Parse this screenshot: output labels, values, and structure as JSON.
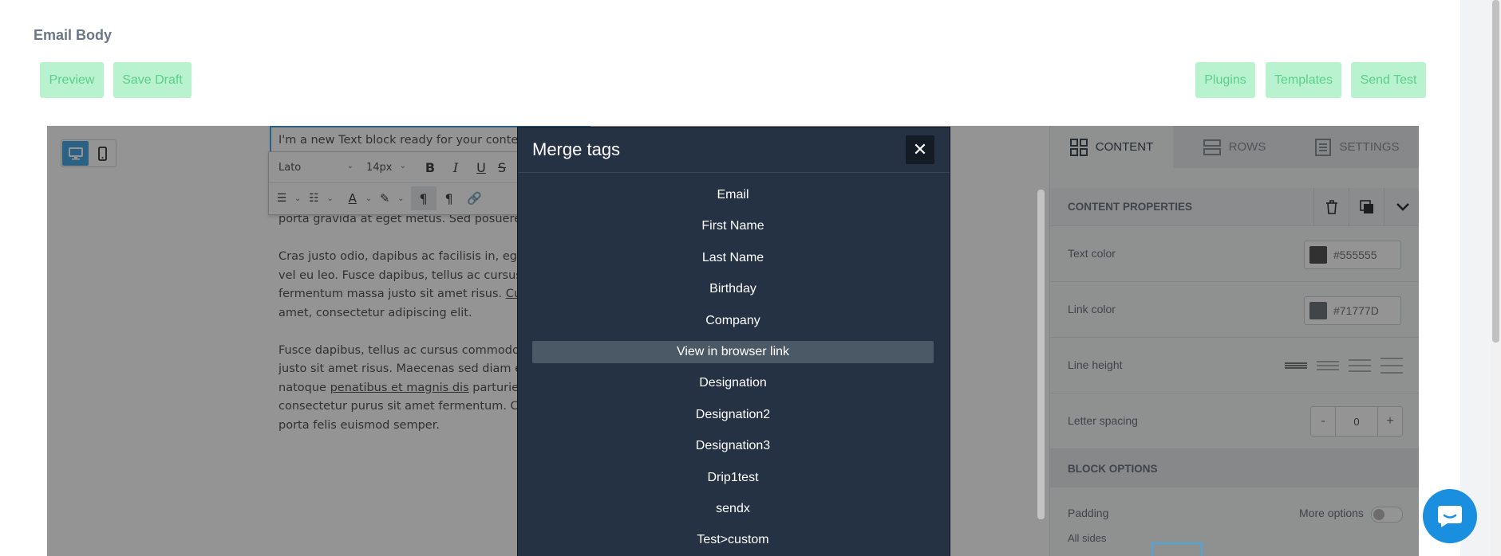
{
  "page": {
    "title": "Email Body"
  },
  "buttons": {
    "preview": "Preview",
    "save_draft": "Save Draft",
    "plugins": "Plugins",
    "templates": "Templates",
    "send_test": "Send Test"
  },
  "canvas": {
    "first_line": "I'm a new Text block ready for your content.",
    "line_2": "porta gravida at eget metus. Sed posuere co",
    "para2": [
      "Cras justo odio, dapibus ac facilisis in, egesta",
      "vel eu leo. Fusce dapibus, tellus ac cursus co",
      "fermentum massa justo sit amet risus. ",
      "amet, consectetur adipiscing elit."
    ],
    "para2_link": "Curab",
    "para3": [
      "Fusce dapibus, tellus ac cursus commodo, to",
      "justo sit amet risus. Maecenas sed diam eget",
      "natoque ",
      "consectetur purus sit amet fermentum. Cura",
      "porta felis euismod semper."
    ],
    "para3_link": "penatibus et magnis dis",
    "para3_after_link": " parturient"
  },
  "toolbar": {
    "font": "Lato",
    "size": "14px"
  },
  "panel": {
    "tabs": [
      "CONTENT",
      "ROWS",
      "SETTINGS"
    ],
    "content_properties": "CONTENT PROPERTIES",
    "text_color_label": "Text color",
    "text_color": "#555555",
    "link_color_label": "Link color",
    "link_color": "#71777D",
    "line_height_label": "Line height",
    "letter_spacing_label": "Letter spacing",
    "letter_spacing_value": "0",
    "minus": "-",
    "plus": "+",
    "block_options": "BLOCK OPTIONS",
    "padding_label": "Padding",
    "more_options": "More options",
    "all_sides": "All sides"
  },
  "modal": {
    "title": "Merge tags",
    "close": "✕",
    "tags": [
      "Email",
      "First Name",
      "Last Name",
      "Birthday",
      "Company",
      "View in browser link",
      "Designation",
      "Designation2",
      "Designation3",
      "Drip1test",
      "sendx",
      "Test>custom"
    ],
    "highlighted": "View in browser link"
  },
  "colors": {
    "accent_green": "#b9f2cf",
    "accent_green_text": "#5ad08a",
    "modal_bg": "#243244",
    "device_active": "#4aa7e6",
    "chat": "#1a8fe0"
  },
  "icons": [
    "desktop-icon",
    "mobile-icon",
    "bold-icon",
    "italic-icon",
    "underline-icon",
    "strikethrough-icon",
    "ordered-list-icon",
    "bullet-list-icon",
    "font-color-icon",
    "highlight-icon",
    "ltr-icon",
    "rtl-icon",
    "link-icon",
    "grid-icon",
    "rows-icon",
    "settings-icon",
    "trash-icon",
    "duplicate-icon",
    "chevron-down-icon",
    "chat-icon"
  ]
}
